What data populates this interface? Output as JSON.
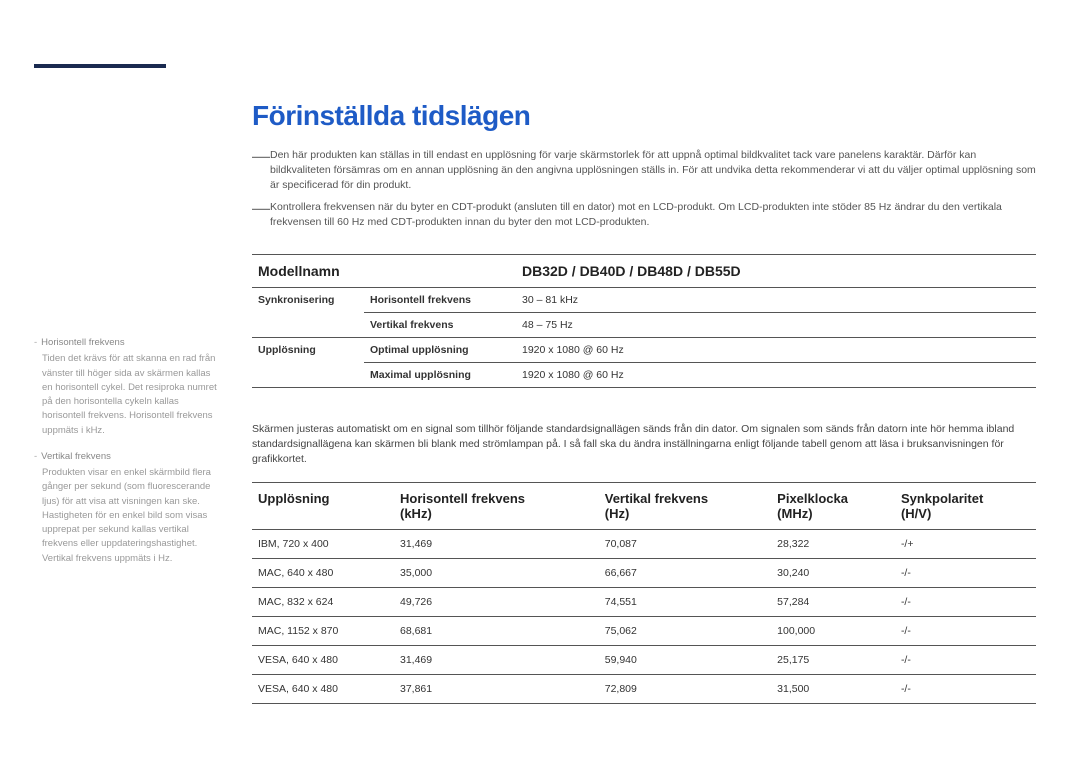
{
  "title": "Förinställda tidslägen",
  "notes": [
    "Den här produkten kan ställas in till endast en upplösning för varje skärmstorlek för att uppnå optimal bildkvalitet tack vare panelens karaktär. Därför kan bildkvaliteten försämras om en annan upplösning än den angivna upplösningen ställs in. För att undvika detta rekommenderar vi att du väljer optimal upplösning som är specificerad för din produkt.",
    "Kontrollera frekvensen när du byter en CDT-produkt (ansluten till en dator) mot en LCD-produkt. Om LCD-produkten inte stöder 85 Hz ändrar du den vertikala frekvensen till 60 Hz med CDT-produkten innan du byter den mot LCD-produkten."
  ],
  "modelTable": {
    "head": {
      "label": "Modellnamn",
      "value": "DB32D / DB40D / DB48D / DB55D"
    },
    "rows": [
      {
        "group": "Synkronisering",
        "label": "Horisontell frekvens",
        "value": "30 – 81 kHz"
      },
      {
        "group": "",
        "label": "Vertikal frekvens",
        "value": "48 – 75 Hz"
      },
      {
        "group": "Upplösning",
        "label": "Optimal upplösning",
        "value": "1920 x 1080 @ 60 Hz"
      },
      {
        "group": "",
        "label": "Maximal upplösning",
        "value": "1920 x 1080 @ 60 Hz"
      }
    ]
  },
  "midParagraph": "Skärmen justeras automatiskt om en signal som tillhör följande standardsignallägen sänds från din dator. Om signalen som sänds från datorn inte hör hemma ibland standardsignallägena kan skärmen bli blank med strömlampan på. I så fall ska du ändra inställningarna enligt följande tabell genom att läsa i bruksanvisningen för grafikkortet.",
  "timingTable": {
    "headers": [
      {
        "t1": "Upplösning",
        "t2": ""
      },
      {
        "t1": "Horisontell frekvens",
        "t2": "(kHz)"
      },
      {
        "t1": "Vertikal frekvens",
        "t2": "(Hz)"
      },
      {
        "t1": "Pixelklocka",
        "t2": "(MHz)"
      },
      {
        "t1": "Synkpolaritet",
        "t2": "(H/V)"
      }
    ],
    "rows": [
      [
        "IBM, 720 x 400",
        "31,469",
        "70,087",
        "28,322",
        "-/+"
      ],
      [
        "MAC, 640 x 480",
        "35,000",
        "66,667",
        "30,240",
        "-/-"
      ],
      [
        "MAC, 832 x 624",
        "49,726",
        "74,551",
        "57,284",
        "-/-"
      ],
      [
        "MAC, 1152 x 870",
        "68,681",
        "75,062",
        "100,000",
        "-/-"
      ],
      [
        "VESA, 640 x 480",
        "31,469",
        "59,940",
        "25,175",
        "-/-"
      ],
      [
        "VESA, 640 x 480",
        "37,861",
        "72,809",
        "31,500",
        "-/-"
      ]
    ]
  },
  "sidebar": {
    "h1": "Horisontell frekvens",
    "p1": "Tiden det krävs för att skanna en rad från vänster till höger sida av skärmen kallas en horisontell cykel. Det resiproka numret på den horisontella cykeln kallas horisontell frekvens. Horisontell frekvens uppmäts i kHz.",
    "h2": "Vertikal frekvens",
    "p2": "Produkten visar en enkel skärmbild flera gånger per sekund (som fluorescerande ljus) för att visa att visningen kan ske. Hastigheten för en enkel bild som visas upprepat per sekund kallas vertikal frekvens eller uppdateringshastighet. Vertikal frekvens uppmäts i Hz."
  }
}
